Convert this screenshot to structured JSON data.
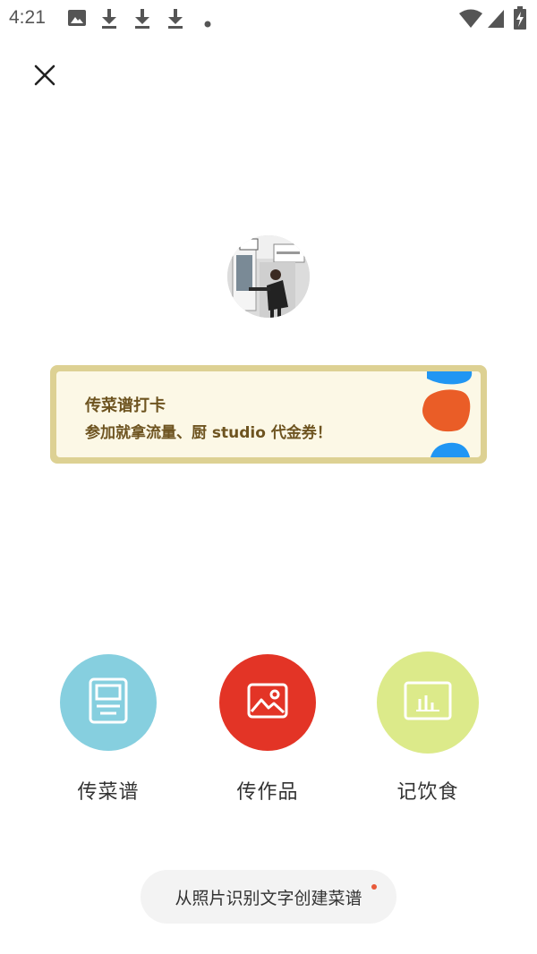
{
  "status_bar": {
    "time": "4:21",
    "left_icons": [
      "image-icon",
      "download-icon",
      "download-icon",
      "download-icon",
      "dot-icon"
    ],
    "right_icons": [
      "wifi-icon",
      "signal-icon",
      "battery-charging-icon"
    ]
  },
  "header": {
    "close_icon": "close-icon"
  },
  "banner": {
    "title": "传菜谱打卡",
    "subtitle": "参加就拿流量、厨 studio 代金券！",
    "colors": {
      "border": "#ddd193",
      "background": "#fcf8e6",
      "text": "#6e5420",
      "blob_orange": "#ea5d27",
      "blob_blue": "#2196f3"
    }
  },
  "actions": [
    {
      "label": "传菜谱",
      "icon": "recipe-document-icon",
      "color": "#86cfdf"
    },
    {
      "label": "传作品",
      "icon": "image-icon",
      "color": "#e33426"
    },
    {
      "label": "记饮食",
      "icon": "chart-icon",
      "color": "#dcea8a"
    }
  ],
  "ocr_button": {
    "label": "从照片识别文字创建菜谱",
    "has_badge_dot": true
  }
}
